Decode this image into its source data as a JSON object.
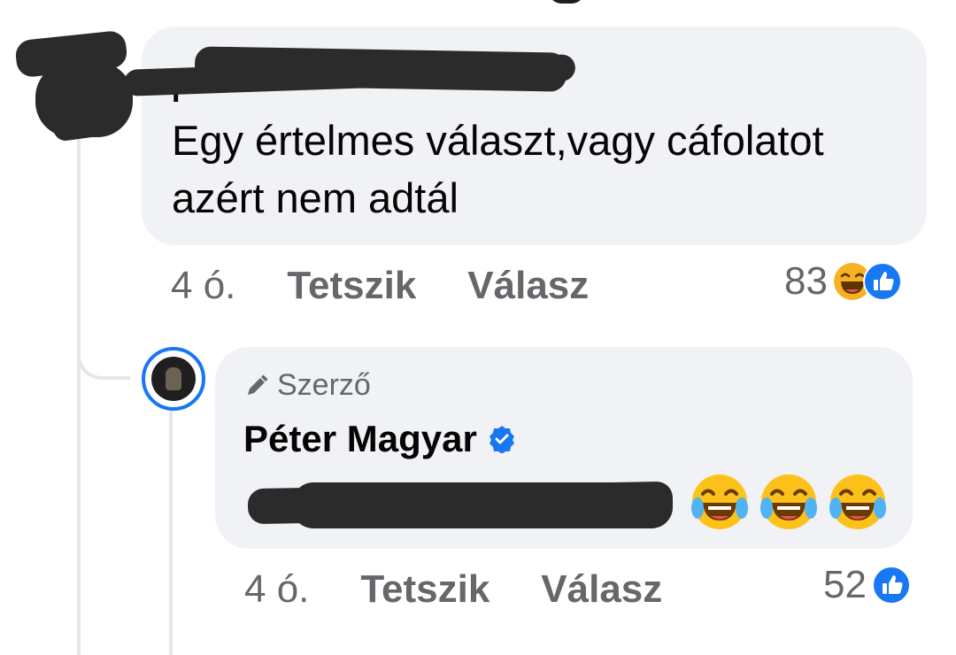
{
  "comment1": {
    "text": "Egy értelmes választ,vagy cáfolatot azért nem adtál",
    "time": "4 ó.",
    "like_label": "Tetszik",
    "reply_label": "Válasz",
    "reaction_count": "83",
    "reaction_icons": [
      "laugh-reaction-icon",
      "like-reaction-icon"
    ]
  },
  "comment2": {
    "badge": "Szerző",
    "author": "Péter Magyar",
    "verified": true,
    "emojis": [
      "face-with-tears-of-joy",
      "face-with-tears-of-joy",
      "face-with-tears-of-joy"
    ],
    "time": "4 ó.",
    "like_label": "Tetszik",
    "reply_label": "Válasz",
    "reaction_count": "52",
    "reaction_icons": [
      "like-reaction-icon"
    ]
  },
  "colors": {
    "bubble_bg": "#f0f2f5",
    "text": "#050505",
    "secondary_text": "#65676b",
    "facebook_blue": "#1877f2",
    "thread_line": "#e4e6eb"
  }
}
